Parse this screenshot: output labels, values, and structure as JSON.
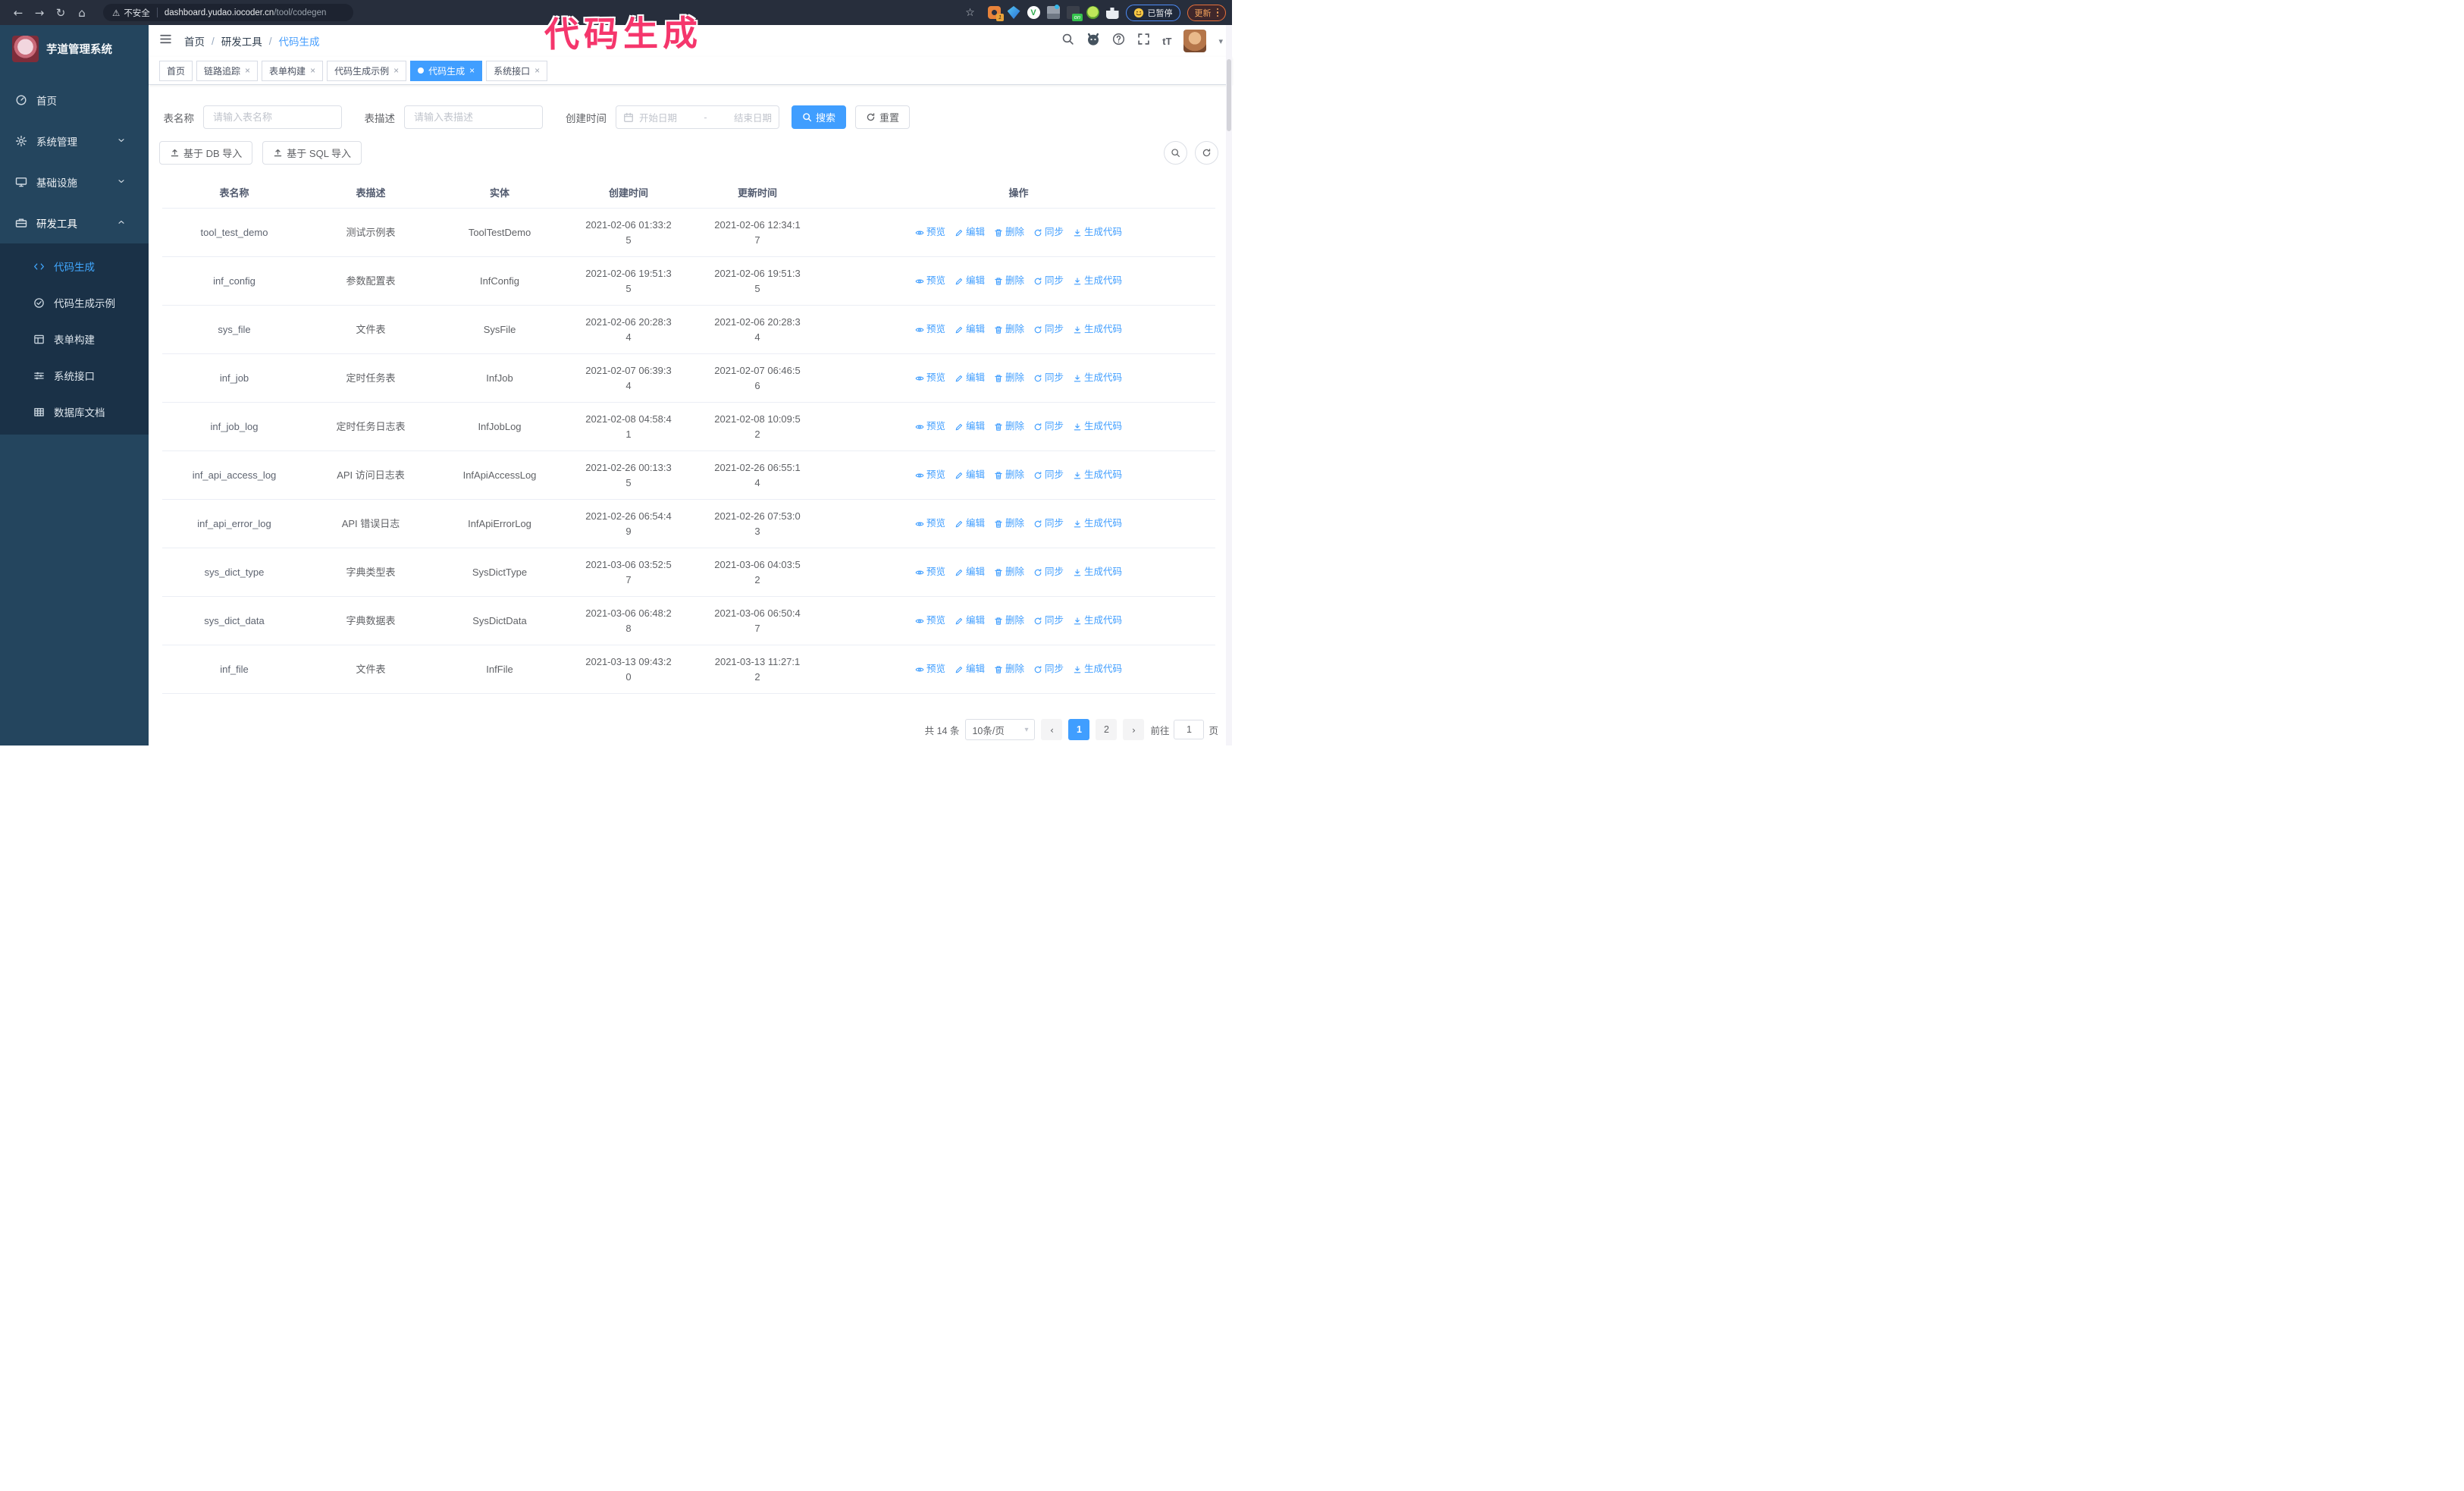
{
  "browser": {
    "security_label": "不安全",
    "url_host": "dashboard.yudao.iocoder.cn",
    "url_path": "/tool/codegen",
    "extension_badge": "1",
    "extension_on_badge": "on",
    "paused_label": "已暂停",
    "update_label": "更新"
  },
  "annotation": {
    "text": "代码生成",
    "color": "#f5366c"
  },
  "sidebar": {
    "logo_title": "芋道管理系统",
    "items": [
      {
        "label": "首页",
        "icon": "dashboard-icon",
        "chevron": "none",
        "active": false
      },
      {
        "label": "系统管理",
        "icon": "gear-icon",
        "chevron": "down",
        "active": false
      },
      {
        "label": "基础设施",
        "icon": "monitor-icon",
        "chevron": "down",
        "active": false
      },
      {
        "label": "研发工具",
        "icon": "toolbox-icon",
        "chevron": "up",
        "active": true
      }
    ],
    "submenu": [
      {
        "label": "代码生成",
        "icon": "code-icon",
        "active": true
      },
      {
        "label": "代码生成示例",
        "icon": "example-icon",
        "active": false
      },
      {
        "label": "表单构建",
        "icon": "form-icon",
        "active": false
      },
      {
        "label": "系统接口",
        "icon": "api-icon",
        "active": false
      },
      {
        "label": "数据库文档",
        "icon": "database-icon",
        "active": false
      }
    ]
  },
  "header": {
    "breadcrumb": [
      "首页",
      "研发工具",
      "代码生成"
    ],
    "separator": "/"
  },
  "tabs": [
    {
      "label": "首页",
      "active": false,
      "closable": false
    },
    {
      "label": "链路追踪",
      "active": false,
      "closable": true
    },
    {
      "label": "表单构建",
      "active": false,
      "closable": true
    },
    {
      "label": "代码生成示例",
      "active": false,
      "closable": true
    },
    {
      "label": "代码生成",
      "active": true,
      "closable": true
    },
    {
      "label": "系统接口",
      "active": false,
      "closable": true
    }
  ],
  "filters": {
    "table_name_label": "表名称",
    "table_name_placeholder": "请输入表名称",
    "table_desc_label": "表描述",
    "table_desc_placeholder": "请输入表描述",
    "create_time_label": "创建时间",
    "date_start_placeholder": "开始日期",
    "date_separator": "-",
    "date_end_placeholder": "结束日期",
    "search_label": "搜索",
    "reset_label": "重置"
  },
  "toolbar": {
    "import_db_label": "基于 DB 导入",
    "import_sql_label": "基于 SQL 导入"
  },
  "table": {
    "columns": [
      "表名称",
      "表描述",
      "实体",
      "创建时间",
      "更新时间",
      "操作"
    ],
    "action_labels": [
      {
        "label": "预览",
        "icon": "eye-icon"
      },
      {
        "label": "编辑",
        "icon": "edit-icon"
      },
      {
        "label": "删除",
        "icon": "delete-icon"
      },
      {
        "label": "同步",
        "icon": "sync-icon"
      },
      {
        "label": "生成代码",
        "icon": "download-icon"
      }
    ],
    "rows": [
      {
        "name": "tool_test_demo",
        "description": "测试示例表",
        "entity": "ToolTestDemo",
        "created": "2021-02-06 01:33:25",
        "updated": "2021-02-06 12:34:17"
      },
      {
        "name": "inf_config",
        "description": "参数配置表",
        "entity": "InfConfig",
        "created": "2021-02-06 19:51:35",
        "updated": "2021-02-06 19:51:35"
      },
      {
        "name": "sys_file",
        "description": "文件表",
        "entity": "SysFile",
        "created": "2021-02-06 20:28:34",
        "updated": "2021-02-06 20:28:34"
      },
      {
        "name": "inf_job",
        "description": "定时任务表",
        "entity": "InfJob",
        "created": "2021-02-07 06:39:34",
        "updated": "2021-02-07 06:46:56"
      },
      {
        "name": "inf_job_log",
        "description": "定时任务日志表",
        "entity": "InfJobLog",
        "created": "2021-02-08 04:58:41",
        "updated": "2021-02-08 10:09:52"
      },
      {
        "name": "inf_api_access_log",
        "description": "API 访问日志表",
        "entity": "InfApiAccessLog",
        "created": "2021-02-26 00:13:35",
        "updated": "2021-02-26 06:55:14"
      },
      {
        "name": "inf_api_error_log",
        "description": "API 错误日志",
        "entity": "InfApiErrorLog",
        "created": "2021-02-26 06:54:49",
        "updated": "2021-02-26 07:53:03"
      },
      {
        "name": "sys_dict_type",
        "description": "字典类型表",
        "entity": "SysDictType",
        "created": "2021-03-06 03:52:57",
        "updated": "2021-03-06 04:03:52"
      },
      {
        "name": "sys_dict_data",
        "description": "字典数据表",
        "entity": "SysDictData",
        "created": "2021-03-06 06:48:28",
        "updated": "2021-03-06 06:50:47"
      },
      {
        "name": "inf_file",
        "description": "文件表",
        "entity": "InfFile",
        "created": "2021-03-13 09:43:20",
        "updated": "2021-03-13 11:27:12"
      }
    ]
  },
  "pagination": {
    "total_label": "共 14 条",
    "page_size_label": "10条/页",
    "pages": [
      "1",
      "2"
    ],
    "active_page": "1",
    "goto_label": "前往",
    "goto_value": "1",
    "page_unit": "页"
  },
  "colors": {
    "accent": "#409eff",
    "sidebar_bg": "#24455e",
    "submenu_bg": "#1a3147",
    "annotation": "#f5366c"
  }
}
